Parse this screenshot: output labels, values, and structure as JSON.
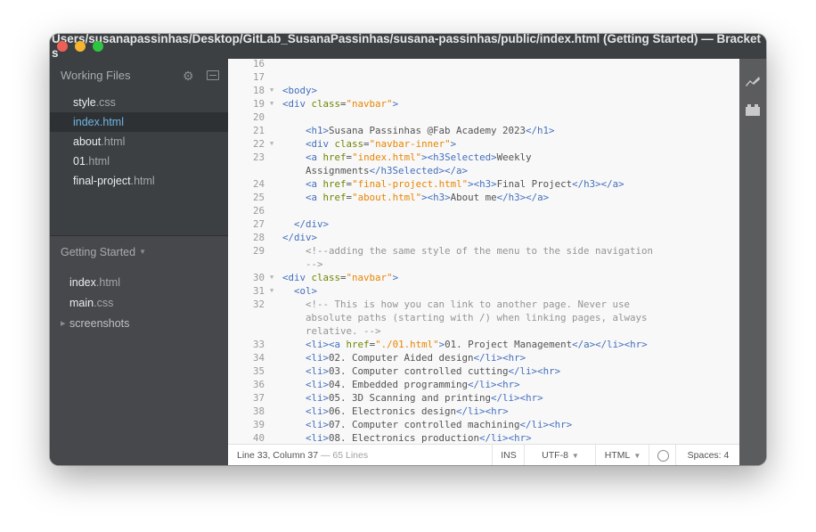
{
  "window": {
    "title": "Users/susanapassinhas/Desktop/GitLab_SusanaPassinhas/susana-passinhas/public/index.html (Getting Started) — Brackets",
    "controls": [
      "close",
      "minimize",
      "maximize"
    ]
  },
  "sidebar": {
    "working_files_label": "Working Files",
    "working_files": [
      {
        "name": "style",
        "ext": ".css",
        "selected": false
      },
      {
        "name": "index",
        "ext": ".html",
        "selected": true
      },
      {
        "name": "about",
        "ext": ".html",
        "selected": false
      },
      {
        "name": "01",
        "ext": ".html",
        "selected": false
      },
      {
        "name": "final-project",
        "ext": ".html",
        "selected": false
      }
    ],
    "project_label": "Getting Started",
    "project_files": [
      {
        "name": "index",
        "ext": ".html"
      },
      {
        "name": "main",
        "ext": ".css"
      },
      {
        "name": "screenshots",
        "ext": "",
        "folder": true
      }
    ],
    "icons": {
      "settings": "gear-icon",
      "split": "split-view-icon"
    }
  },
  "editor": {
    "lines": [
      {
        "n": "16",
        "fold": false,
        "tokens": []
      },
      {
        "n": "17",
        "fold": false,
        "tokens": []
      },
      {
        "n": "18",
        "fold": true,
        "tokens": [
          [
            "tag",
            "<body>"
          ]
        ]
      },
      {
        "n": "19",
        "fold": true,
        "tokens": [
          [
            "tag",
            "<div "
          ],
          [
            "attr",
            "class"
          ],
          [
            "txt",
            "="
          ],
          [
            "str",
            "\"navbar\""
          ],
          [
            "tag",
            ">"
          ]
        ]
      },
      {
        "n": "20",
        "fold": false,
        "tokens": []
      },
      {
        "n": "21",
        "fold": false,
        "tokens": [
          [
            "txt",
            "    "
          ],
          [
            "tag",
            "<h1>"
          ],
          [
            "txt",
            "Susana Passinhas @Fab Academy 2023"
          ],
          [
            "tag",
            "</h1>"
          ]
        ]
      },
      {
        "n": "22",
        "fold": true,
        "tokens": [
          [
            "txt",
            "    "
          ],
          [
            "tag",
            "<div "
          ],
          [
            "attr",
            "class"
          ],
          [
            "txt",
            "="
          ],
          [
            "str",
            "\"navbar-inner\""
          ],
          [
            "tag",
            ">"
          ]
        ]
      },
      {
        "n": "23",
        "fold": false,
        "tokens": [
          [
            "txt",
            "    "
          ],
          [
            "tag",
            "<a "
          ],
          [
            "attr",
            "href"
          ],
          [
            "txt",
            "="
          ],
          [
            "str",
            "\"index.html\""
          ],
          [
            "tag",
            ">"
          ],
          [
            "tag",
            "<h3Selected>"
          ],
          [
            "txt",
            "Weekly"
          ]
        ]
      },
      {
        "n": "",
        "fold": false,
        "tokens": [
          [
            "txt",
            "    Assignments"
          ],
          [
            "tag",
            "</h3Selected>"
          ],
          [
            "tag",
            "</a>"
          ]
        ]
      },
      {
        "n": "24",
        "fold": false,
        "tokens": [
          [
            "txt",
            "    "
          ],
          [
            "tag",
            "<a "
          ],
          [
            "attr",
            "href"
          ],
          [
            "txt",
            "="
          ],
          [
            "str",
            "\"final-project.html\""
          ],
          [
            "tag",
            ">"
          ],
          [
            "tag",
            "<h3>"
          ],
          [
            "txt",
            "Final Project"
          ],
          [
            "tag",
            "</h3>"
          ],
          [
            "tag",
            "</a>"
          ]
        ]
      },
      {
        "n": "25",
        "fold": false,
        "tokens": [
          [
            "txt",
            "    "
          ],
          [
            "tag",
            "<a "
          ],
          [
            "attr",
            "href"
          ],
          [
            "txt",
            "="
          ],
          [
            "str",
            "\"about.html\""
          ],
          [
            "tag",
            ">"
          ],
          [
            "tag",
            "<h3>"
          ],
          [
            "txt",
            "About me"
          ],
          [
            "tag",
            "</h3>"
          ],
          [
            "tag",
            "</a>"
          ]
        ]
      },
      {
        "n": "26",
        "fold": false,
        "tokens": []
      },
      {
        "n": "27",
        "fold": false,
        "tokens": [
          [
            "txt",
            "  "
          ],
          [
            "tag",
            "</div>"
          ]
        ]
      },
      {
        "n": "28",
        "fold": false,
        "tokens": [
          [
            "tag",
            "</div>"
          ]
        ]
      },
      {
        "n": "29",
        "fold": false,
        "tokens": [
          [
            "cmt",
            "    <!--adding the same style of the menu to the side navigation"
          ]
        ]
      },
      {
        "n": "",
        "fold": false,
        "tokens": [
          [
            "cmt",
            "    -->"
          ]
        ]
      },
      {
        "n": "30",
        "fold": true,
        "tokens": [
          [
            "tag",
            "<div "
          ],
          [
            "attr",
            "class"
          ],
          [
            "txt",
            "="
          ],
          [
            "str",
            "\"navbar\""
          ],
          [
            "tag",
            ">"
          ]
        ]
      },
      {
        "n": "31",
        "fold": true,
        "tokens": [
          [
            "txt",
            "  "
          ],
          [
            "tag",
            "<ol>"
          ]
        ]
      },
      {
        "n": "32",
        "fold": false,
        "tokens": [
          [
            "cmt",
            "    <!-- This is how you can link to another page. Never use"
          ]
        ]
      },
      {
        "n": "",
        "fold": false,
        "tokens": [
          [
            "cmt",
            "    absolute paths (starting with /) when linking pages, always"
          ]
        ]
      },
      {
        "n": "",
        "fold": false,
        "tokens": [
          [
            "cmt",
            "    relative. -->"
          ]
        ]
      },
      {
        "n": "33",
        "fold": false,
        "tokens": [
          [
            "txt",
            "    "
          ],
          [
            "tag",
            "<li>"
          ],
          [
            "tag",
            "<a "
          ],
          [
            "attr",
            "href"
          ],
          [
            "txt",
            "="
          ],
          [
            "str",
            "\"./01.html\""
          ],
          [
            "tag",
            ">"
          ],
          [
            "txt",
            "01. Project Management"
          ],
          [
            "tag",
            "</a>"
          ],
          [
            "tag",
            "</li>"
          ],
          [
            "tag",
            "<hr>"
          ]
        ]
      },
      {
        "n": "34",
        "fold": false,
        "tokens": [
          [
            "txt",
            "    "
          ],
          [
            "tag",
            "<li>"
          ],
          [
            "txt",
            "02. Computer Aided design"
          ],
          [
            "tag",
            "</li>"
          ],
          [
            "tag",
            "<hr>"
          ]
        ]
      },
      {
        "n": "35",
        "fold": false,
        "tokens": [
          [
            "txt",
            "    "
          ],
          [
            "tag",
            "<li>"
          ],
          [
            "txt",
            "03. Computer controlled cutting"
          ],
          [
            "tag",
            "</li>"
          ],
          [
            "tag",
            "<hr>"
          ]
        ]
      },
      {
        "n": "36",
        "fold": false,
        "tokens": [
          [
            "txt",
            "    "
          ],
          [
            "tag",
            "<li>"
          ],
          [
            "txt",
            "04. Embedded programming"
          ],
          [
            "tag",
            "</li>"
          ],
          [
            "tag",
            "<hr>"
          ]
        ]
      },
      {
        "n": "37",
        "fold": false,
        "tokens": [
          [
            "txt",
            "    "
          ],
          [
            "tag",
            "<li>"
          ],
          [
            "txt",
            "05. 3D Scanning and printing"
          ],
          [
            "tag",
            "</li>"
          ],
          [
            "tag",
            "<hr>"
          ]
        ]
      },
      {
        "n": "38",
        "fold": false,
        "tokens": [
          [
            "txt",
            "    "
          ],
          [
            "tag",
            "<li>"
          ],
          [
            "txt",
            "06. Electronics design"
          ],
          [
            "tag",
            "</li>"
          ],
          [
            "tag",
            "<hr>"
          ]
        ]
      },
      {
        "n": "39",
        "fold": false,
        "tokens": [
          [
            "txt",
            "    "
          ],
          [
            "tag",
            "<li>"
          ],
          [
            "txt",
            "07. Computer controlled machining"
          ],
          [
            "tag",
            "</li>"
          ],
          [
            "tag",
            "<hr>"
          ]
        ]
      },
      {
        "n": "40",
        "fold": false,
        "tokens": [
          [
            "txt",
            "    "
          ],
          [
            "tag",
            "<li>"
          ],
          [
            "txt",
            "08. Electronics production"
          ],
          [
            "tag",
            "</li>"
          ],
          [
            "tag",
            "<hr>"
          ]
        ]
      }
    ]
  },
  "statusbar": {
    "position": "Line 33, Column 37",
    "line_count": "— 65 Lines",
    "mode": "INS",
    "encoding": "UTF-8",
    "language": "HTML",
    "indent": "Spaces:  4"
  },
  "toolbar_right": {
    "icons": [
      "live-preview-icon",
      "extension-manager-icon"
    ]
  },
  "colors": {
    "tag": "#446fbd",
    "attr": "#6d8600",
    "string": "#e88501",
    "comment": "#949494",
    "selected_file": "#6fb6e6"
  }
}
